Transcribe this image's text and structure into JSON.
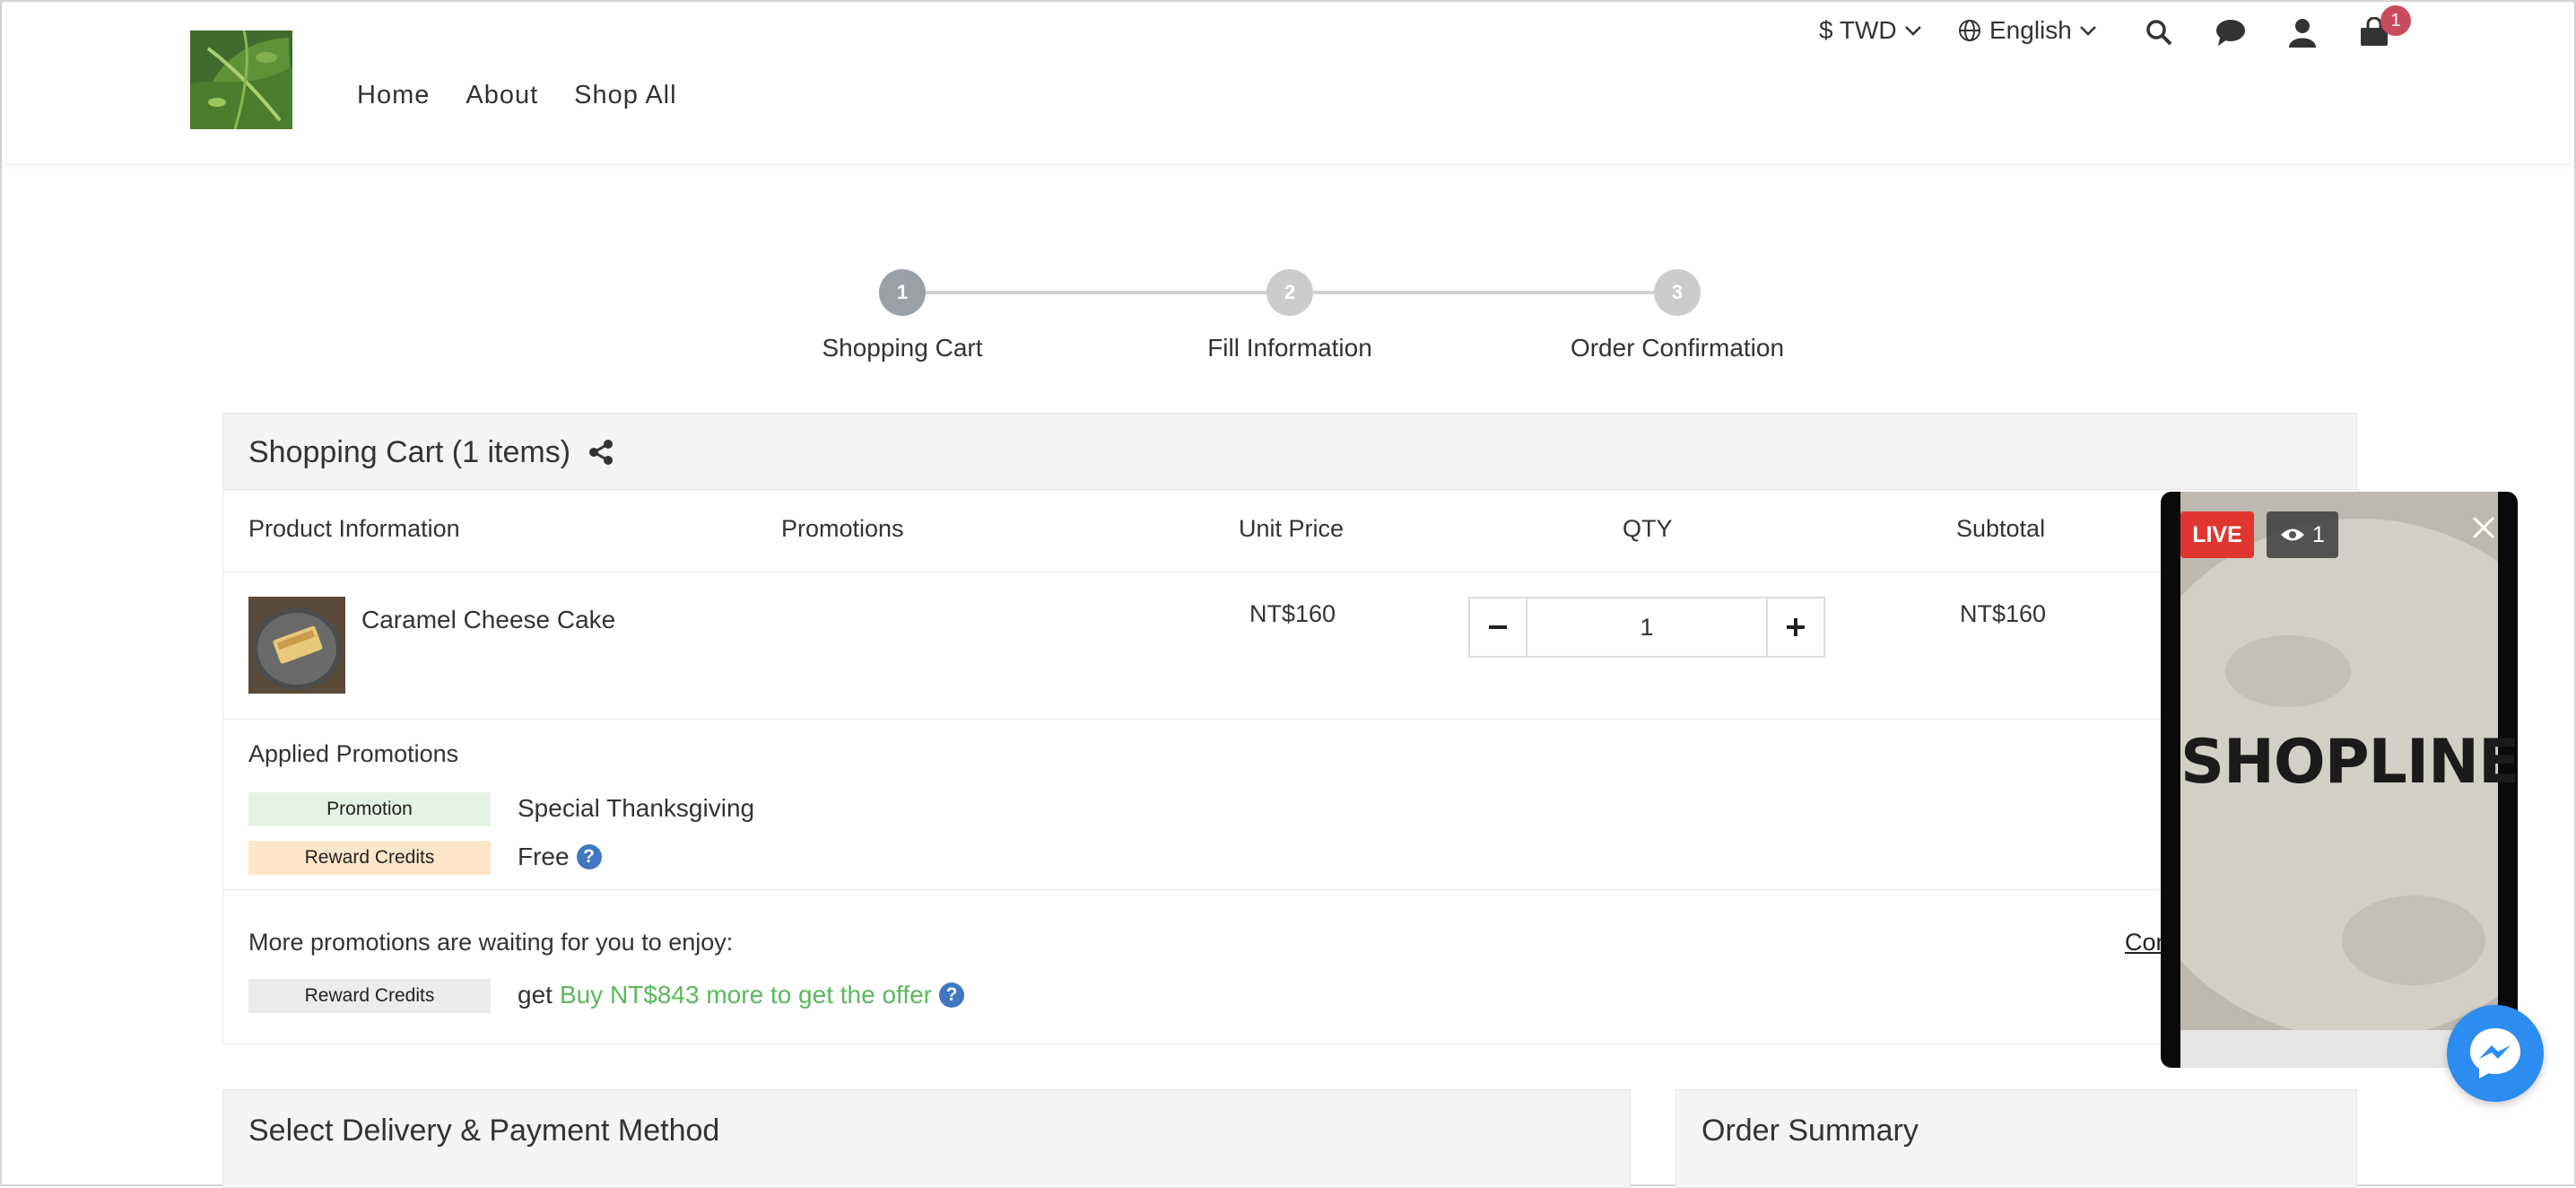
{
  "header": {
    "nav": [
      "Home",
      "About",
      "Shop All"
    ],
    "currency": "$ TWD",
    "language": "English",
    "cart_count": "1"
  },
  "stepper": {
    "steps": [
      {
        "number": "1",
        "label": "Shopping Cart"
      },
      {
        "number": "2",
        "label": "Fill Information"
      },
      {
        "number": "3",
        "label": "Order Confirmation"
      }
    ],
    "active_step": 1
  },
  "cart": {
    "title": "Shopping Cart  (1 items)",
    "columns": [
      "Product Information",
      "Promotions",
      "Unit Price",
      "QTY",
      "Subtotal"
    ],
    "items": [
      {
        "name": "Caramel Cheese Cake",
        "unit_price": "NT$160",
        "qty": "1",
        "subtotal": "NT$160"
      }
    ],
    "applied_label": "Applied Promotions",
    "applied": [
      {
        "tag": "Promotion",
        "text": "Special Thanksgiving"
      },
      {
        "tag": "Reward Credits",
        "text": "Free"
      }
    ],
    "more_label": "More promotions are waiting for you to enjoy:",
    "more": {
      "tag": "Reward Credits",
      "prefix": "get",
      "offer": "Buy NT$843 more to get the offer"
    },
    "more_link": "Con"
  },
  "delivery": {
    "title": "Select Delivery & Payment Method"
  },
  "summary": {
    "title": "Order Summary"
  },
  "live": {
    "badge": "LIVE",
    "viewers": "1",
    "brand": "SHOPLINE"
  },
  "colors": {
    "live_red": "#e0362f",
    "offer_green": "#5cb85c",
    "badge_red": "#c94b5e",
    "messenger_blue": "#2d8cf0"
  }
}
